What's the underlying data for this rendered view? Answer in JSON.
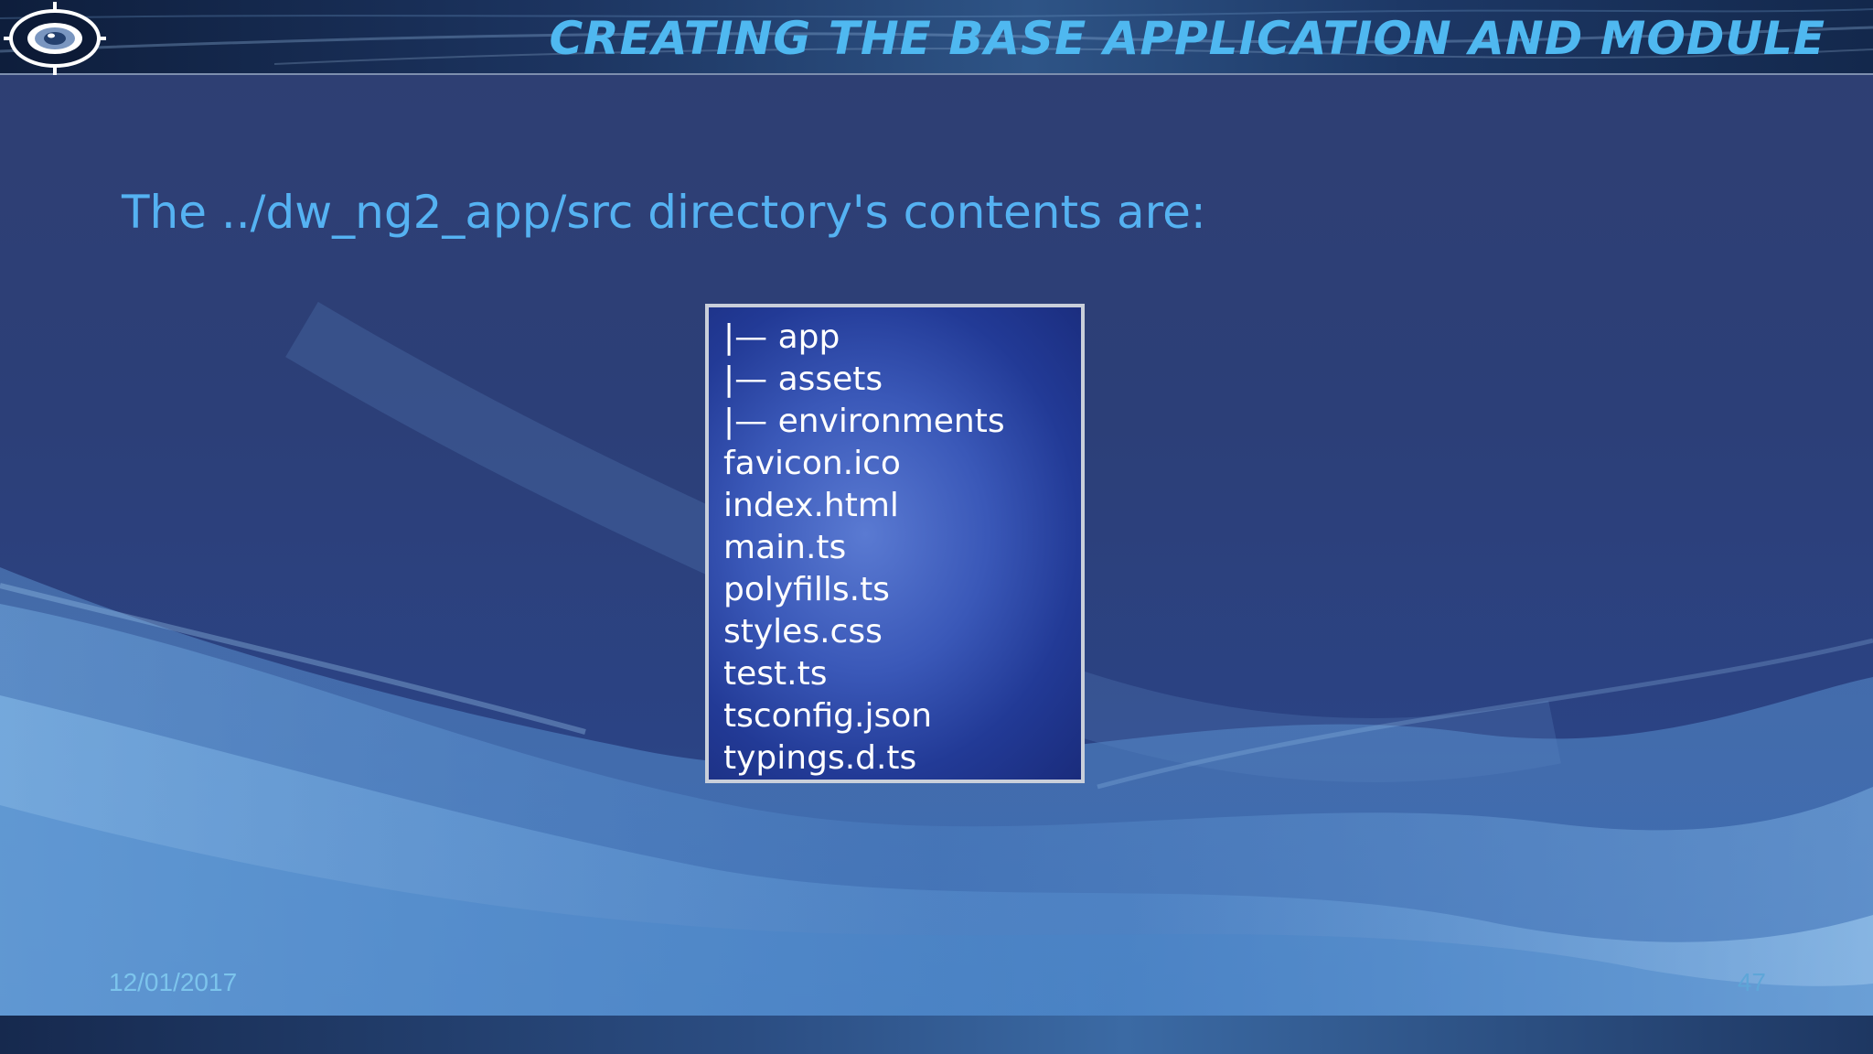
{
  "header": {
    "title": "CREATING THE BASE APPLICATION AND MODULE",
    "logo_icon": "target-eye-icon"
  },
  "main": {
    "intro": "The ../dw_ng2_app/src directory's contents are:",
    "directory_listing": [
      "|— app",
      "|— assets",
      "|— environments",
      "favicon.ico",
      "index.html",
      "main.ts",
      "polyfills.ts",
      "styles.css",
      "test.ts",
      "tsconfig.json",
      "typings.d.ts"
    ]
  },
  "footer": {
    "date": "12/01/2017",
    "page_number": "47"
  },
  "colors": {
    "title": "#4fb8f0",
    "intro_text": "#55b2f2",
    "background": "#2c3f78",
    "box_background": "#3a58b8",
    "box_border": "#c9cfda"
  }
}
